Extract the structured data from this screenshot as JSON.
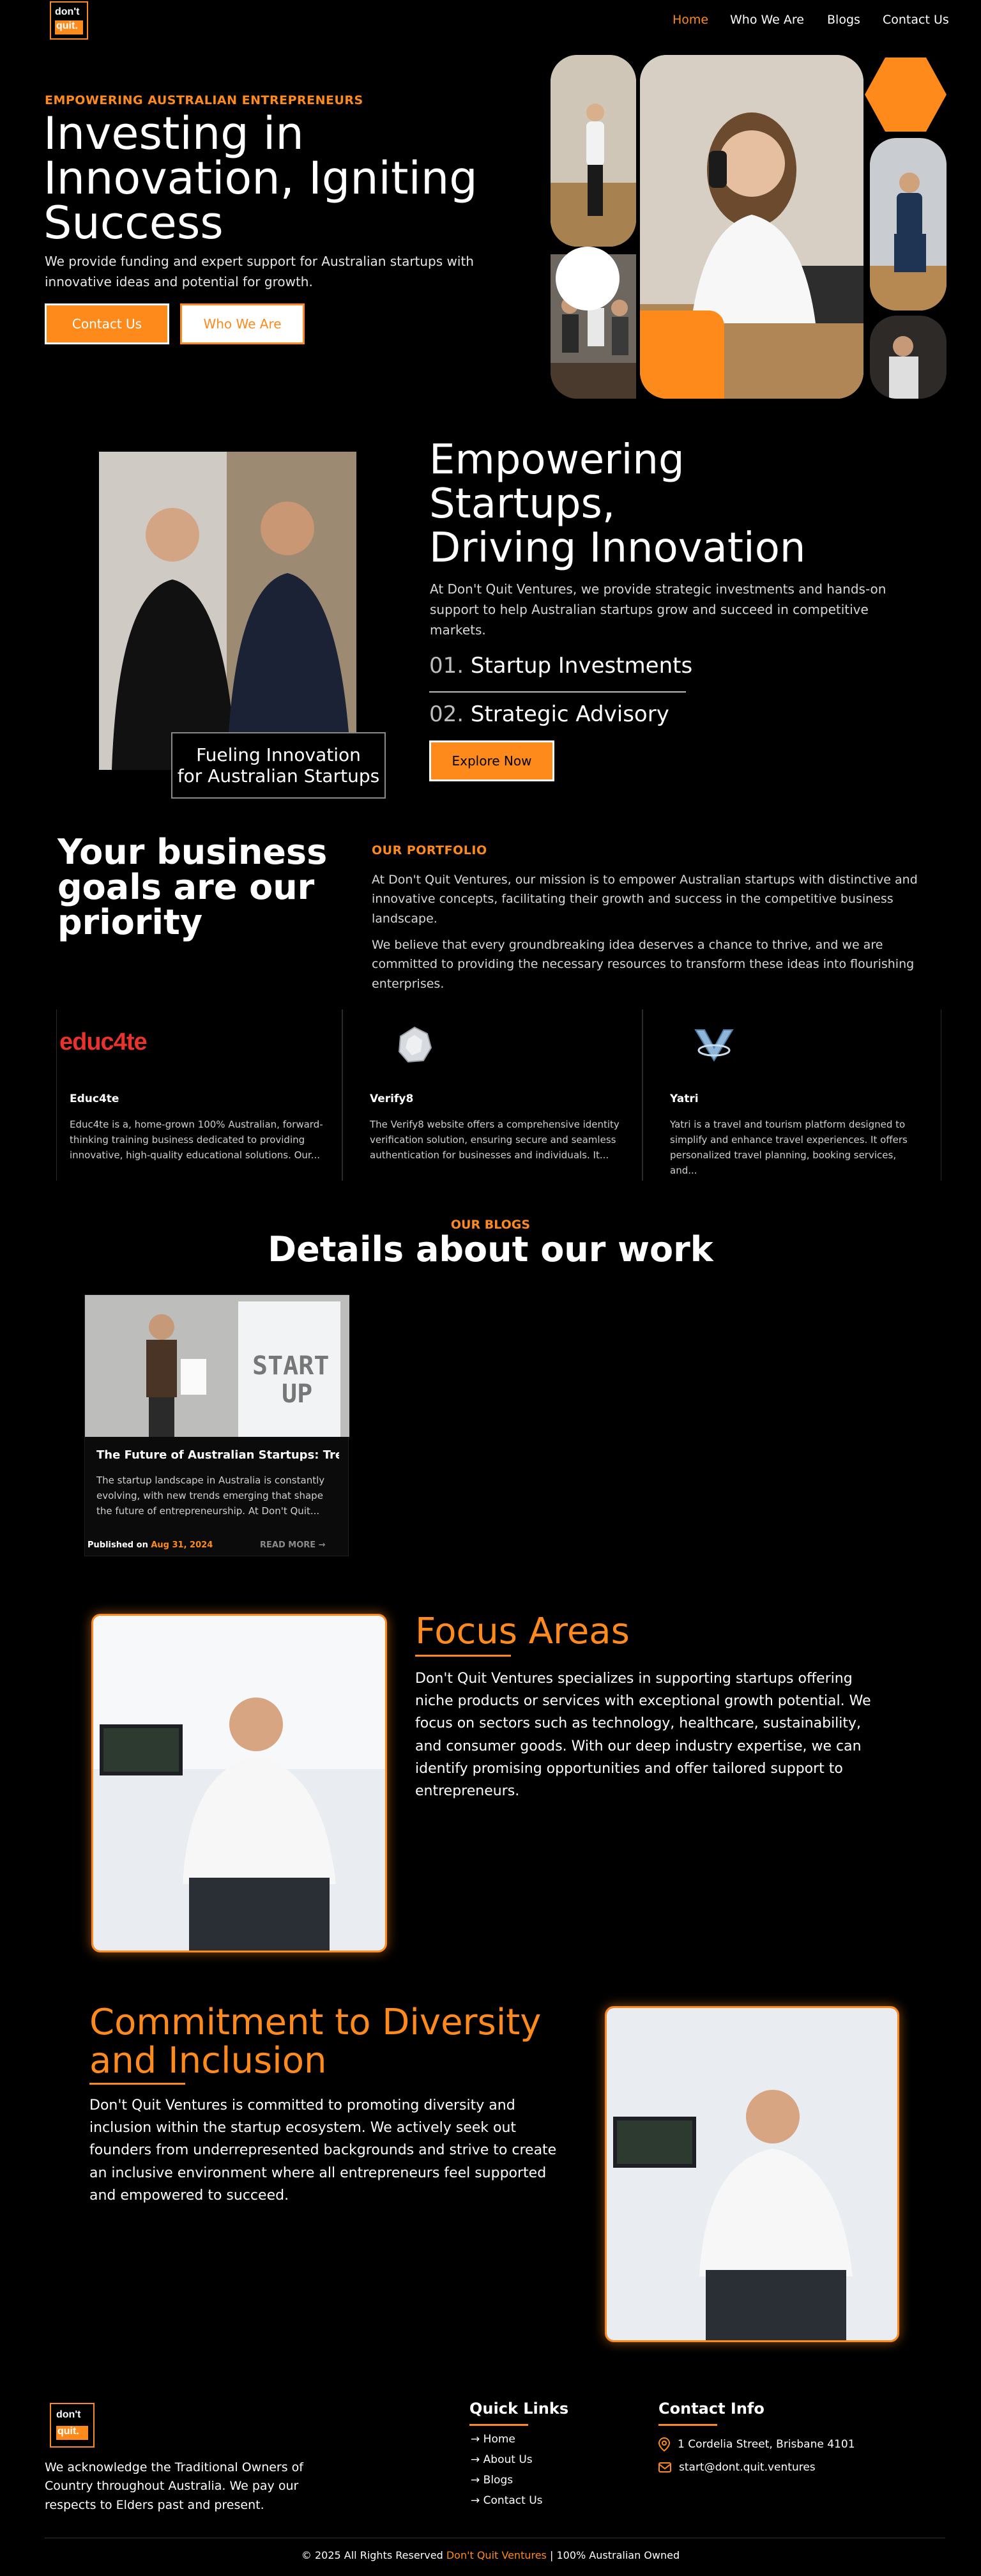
{
  "brand": {
    "logo_line1": "don't",
    "logo_line2": "quit."
  },
  "nav": {
    "items": [
      "Home",
      "Who We Are",
      "Blogs",
      "Contact Us"
    ],
    "active": "Home"
  },
  "hero": {
    "kicker": "EMPOWERING AUSTRALIAN ENTREPRENEURS",
    "title_line1": "Investing in",
    "title_line2": "Innovation, Igniting",
    "title_line3": "Success",
    "subtitle": "We provide funding and expert support for Australian startups with innovative ideas and potential for growth.",
    "btn_contact": "Contact Us",
    "btn_who": "Who We Are"
  },
  "about": {
    "photo_caption_line1": "Fueling Innovation",
    "photo_caption_line2": "for Australian Startups",
    "title_line1": "Empowering",
    "title_line2": "Startups,",
    "title_line3": "Driving Innovation",
    "text": "At Don't Quit Ventures, we provide strategic investments and hands-on support to help Australian startups grow and succeed in competitive markets.",
    "items": [
      {
        "num": "01.",
        "label": "Startup Investments"
      },
      {
        "num": "02.",
        "label": "Strategic Advisory"
      }
    ],
    "cta": "Explore Now"
  },
  "portfolio": {
    "title_line1": "Your business",
    "title_line2": "goals are our",
    "title_line3": "priority",
    "kicker": "OUR PORTFOLIO",
    "para1": "At Don't Quit Ventures, our mission is to empower Australian startups with distinctive and innovative concepts, facilitating their growth and success in the competitive business landscape.",
    "para2": "We believe that every groundbreaking idea deserves a chance to thrive, and we are committed to providing the necessary resources to transform these ideas into flourishing enterprises.",
    "cards": [
      {
        "logo_text": "educ4te",
        "title": "Educ4te",
        "text": "Educ4te is a, home-grown 100% Australian, forward-thinking training business dedicated to providing innovative, high-quality educational solutions. Our..."
      },
      {
        "logo_text": "",
        "title": "Verify8",
        "text": "The Verify8 website offers a comprehensive identity verification solution, ensuring secure and seamless authentication for businesses and individuals. It..."
      },
      {
        "logo_text": "",
        "title": "Yatri",
        "text": "Yatri is a travel and tourism platform designed to simplify and enhance travel experiences. It offers personalized travel planning, booking services, and..."
      }
    ]
  },
  "blogs": {
    "kicker": "OUR BLOGS",
    "title": "Details about our work",
    "post": {
      "title": "The Future of Australian Startups: Trends to...",
      "excerpt": "The startup landscape in Australia is constantly evolving, with new trends emerging that shape the future of entrepreneurship. At Don't Quit...",
      "published_label": "Published on",
      "date": "Aug 31, 2024",
      "read_more": "READ MORE",
      "whiteboard_text_1": "START",
      "whiteboard_text_2": "UP"
    }
  },
  "focus": {
    "title": "Focus Areas",
    "text": "Don't Quit Ventures specializes in supporting startups offering niche products or services with exceptional growth potential. We focus on sectors such as technology, healthcare, sustainability, and consumer goods. With our deep industry expertise, we can identify promising opportunities and offer tailored support to entrepreneurs."
  },
  "diversity": {
    "title_line1": "Commitment to Diversity",
    "title_line2": "and Inclusion",
    "text": "Don't Quit Ventures is committed to promoting diversity and inclusion within the startup ecosystem. We actively seek out founders from underrepresented backgrounds and strive to create an inclusive environment where all entrepreneurs feel supported and empowered to succeed."
  },
  "footer": {
    "acknowledgement": "We acknowledge the Traditional Owners of Country throughout Australia. We pay our respects to Elders past and present.",
    "quick_links_title": "Quick Links",
    "quick_links": [
      "Home",
      "About Us",
      "Blogs",
      "Contact Us"
    ],
    "contact_title": "Contact Info",
    "address": "1 Cordelia Street, Brisbane 4101",
    "email": "start@dont.quit.ventures",
    "copyright_prefix": "© 2025 All Rights Reserved",
    "copyright_brand": "Don't Quit Ventures",
    "copyright_suffix": "| 100% Australian Owned"
  },
  "colors": {
    "accent": "#ff8a1c",
    "background": "#000000",
    "text": "#ffffff"
  }
}
